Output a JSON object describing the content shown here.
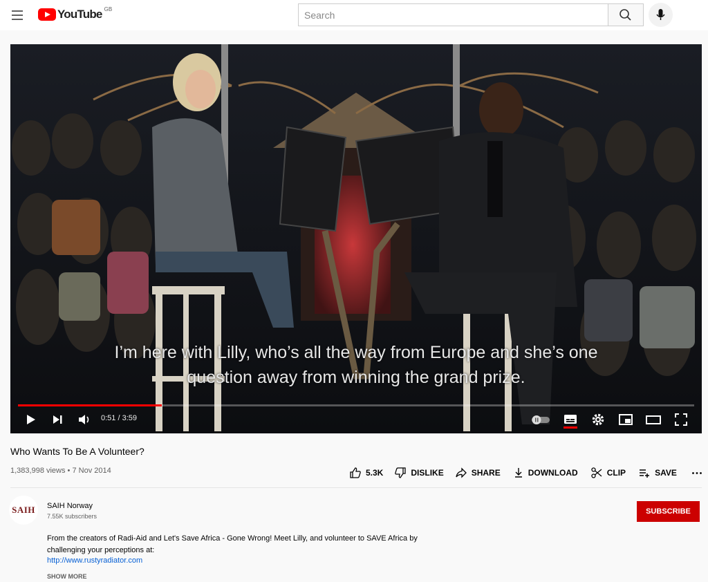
{
  "header": {
    "logo_text": "YouTube",
    "region": "GB",
    "search_placeholder": "Search"
  },
  "player": {
    "subtitle_line1": "I’m here with Lilly, who’s all the way from Europe and she’s one",
    "subtitle_line2": "question away from winning the grand prize.",
    "time": "0:51 / 3:59",
    "progress": 0.213
  },
  "video": {
    "title": "Who Wants To Be A Volunteer?",
    "meta": "1,383,998 views • 7 Nov 2014",
    "actions": {
      "like": "5.3K",
      "dislike": "DISLIKE",
      "share": "SHARE",
      "download": "DOWNLOAD",
      "clip": "CLIP",
      "save": "SAVE"
    }
  },
  "channel": {
    "avatar_text": "SAIH",
    "name": "SAIH Norway",
    "subscribers": "7.55K subscribers",
    "subscribe_label": "SUBSCRIBE"
  },
  "description": {
    "text": "From the creators of Radi-Aid and Let's Save Africa - Gone Wrong! Meet Lilly, and volunteer to SAVE Africa by challenging your perceptions at:",
    "link": "http://www.rustyradiator.com",
    "show_more": "SHOW MORE"
  },
  "colors": {
    "brand_red": "#ff0000",
    "subscribe_red": "#cc0000",
    "link_blue": "#065fd4"
  }
}
